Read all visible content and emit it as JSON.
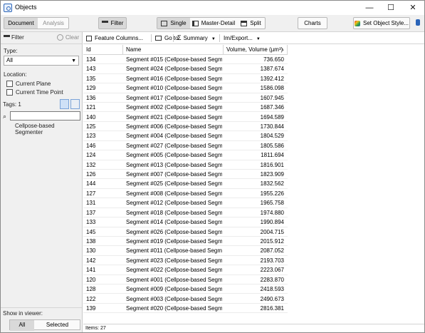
{
  "window": {
    "title": "Objects",
    "minimize": "—",
    "maximize": "☐",
    "close": "✕"
  },
  "toolbar": {
    "document_tab": "Document",
    "analysis_tab": "Analysis",
    "filter_button": "Filter",
    "view_single": "Single",
    "view_master_detail": "Master-Detail",
    "view_split": "Split",
    "charts_button": "Charts",
    "set_style_button": "Set Object Style..."
  },
  "filter_panel": {
    "title": "Filter",
    "clear": "Clear",
    "type_label": "Type:",
    "type_value": "All",
    "location_label": "Location:",
    "current_plane": "Current Plane",
    "current_time_point": "Current Time Point",
    "tags_label": "Tags: 1",
    "search_value": "",
    "tag_item": "Cellpose-based Segmenter",
    "show_in_viewer": "Show in viewer:",
    "show_all": "All",
    "show_selected": "Selected"
  },
  "grid_toolbar": {
    "feature_columns": "Feature Columns...",
    "go_to": "Go to",
    "summary": "Summary",
    "im_export": "Im/Export..."
  },
  "columns": [
    "Id",
    "Name",
    "Volume, Volume (µm³)"
  ],
  "rows": [
    {
      "id": "134",
      "name": "Segment #015 (Cellpose-based Segme...",
      "volume": "736.650"
    },
    {
      "id": "143",
      "name": "Segment #024 (Cellpose-based Segme...",
      "volume": "1387.674"
    },
    {
      "id": "135",
      "name": "Segment #016 (Cellpose-based Segme...",
      "volume": "1392.412"
    },
    {
      "id": "129",
      "name": "Segment #010 (Cellpose-based Segme...",
      "volume": "1586.098"
    },
    {
      "id": "136",
      "name": "Segment #017 (Cellpose-based Segme...",
      "volume": "1607.945"
    },
    {
      "id": "121",
      "name": "Segment #002 (Cellpose-based Segme...",
      "volume": "1687.346"
    },
    {
      "id": "140",
      "name": "Segment #021 (Cellpose-based Segme...",
      "volume": "1694.589"
    },
    {
      "id": "125",
      "name": "Segment #006 (Cellpose-based Segme...",
      "volume": "1730.844"
    },
    {
      "id": "123",
      "name": "Segment #004 (Cellpose-based Segme...",
      "volume": "1804.529"
    },
    {
      "id": "146",
      "name": "Segment #027 (Cellpose-based Segme...",
      "volume": "1805.586"
    },
    {
      "id": "124",
      "name": "Segment #005 (Cellpose-based Segme...",
      "volume": "1811.694"
    },
    {
      "id": "132",
      "name": "Segment #013 (Cellpose-based Segme...",
      "volume": "1816.901"
    },
    {
      "id": "126",
      "name": "Segment #007 (Cellpose-based Segme...",
      "volume": "1823.909"
    },
    {
      "id": "144",
      "name": "Segment #025 (Cellpose-based Segme...",
      "volume": "1832.562"
    },
    {
      "id": "127",
      "name": "Segment #008 (Cellpose-based Segme...",
      "volume": "1955.226"
    },
    {
      "id": "131",
      "name": "Segment #012 (Cellpose-based Segme...",
      "volume": "1965.758"
    },
    {
      "id": "137",
      "name": "Segment #018 (Cellpose-based Segme...",
      "volume": "1974.880"
    },
    {
      "id": "133",
      "name": "Segment #014 (Cellpose-based Segme...",
      "volume": "1990.894"
    },
    {
      "id": "145",
      "name": "Segment #026 (Cellpose-based Segme...",
      "volume": "2004.715"
    },
    {
      "id": "138",
      "name": "Segment #019 (Cellpose-based Segme...",
      "volume": "2015.912"
    },
    {
      "id": "130",
      "name": "Segment #011 (Cellpose-based Segme...",
      "volume": "2087.052"
    },
    {
      "id": "142",
      "name": "Segment #023 (Cellpose-based Segme...",
      "volume": "2193.703"
    },
    {
      "id": "141",
      "name": "Segment #022 (Cellpose-based Segme...",
      "volume": "2223.067"
    },
    {
      "id": "120",
      "name": "Segment #001 (Cellpose-based Segme...",
      "volume": "2283.870"
    },
    {
      "id": "128",
      "name": "Segment #009 (Cellpose-based Segme...",
      "volume": "2418.593"
    },
    {
      "id": "122",
      "name": "Segment #003 (Cellpose-based Segme...",
      "volume": "2490.673"
    },
    {
      "id": "139",
      "name": "Segment #020 (Cellpose-based Segme...",
      "volume": "2816.381"
    }
  ],
  "status": {
    "items_text": "Items: 27"
  },
  "colors": {
    "accent": "#2a64b8",
    "toolbar_bg": "#f0f0f0",
    "active_button": "#d9d9d9"
  },
  "icons": [
    "app-objects-icon",
    "filter-icon",
    "clear-icon",
    "single-view-icon",
    "master-detail-icon",
    "split-icon",
    "palette-icon",
    "pin-icon",
    "feature-columns-icon",
    "go-to-icon",
    "summary-icon",
    "search-icon",
    "tag-view-icon",
    "sort-ascending-icon"
  ]
}
